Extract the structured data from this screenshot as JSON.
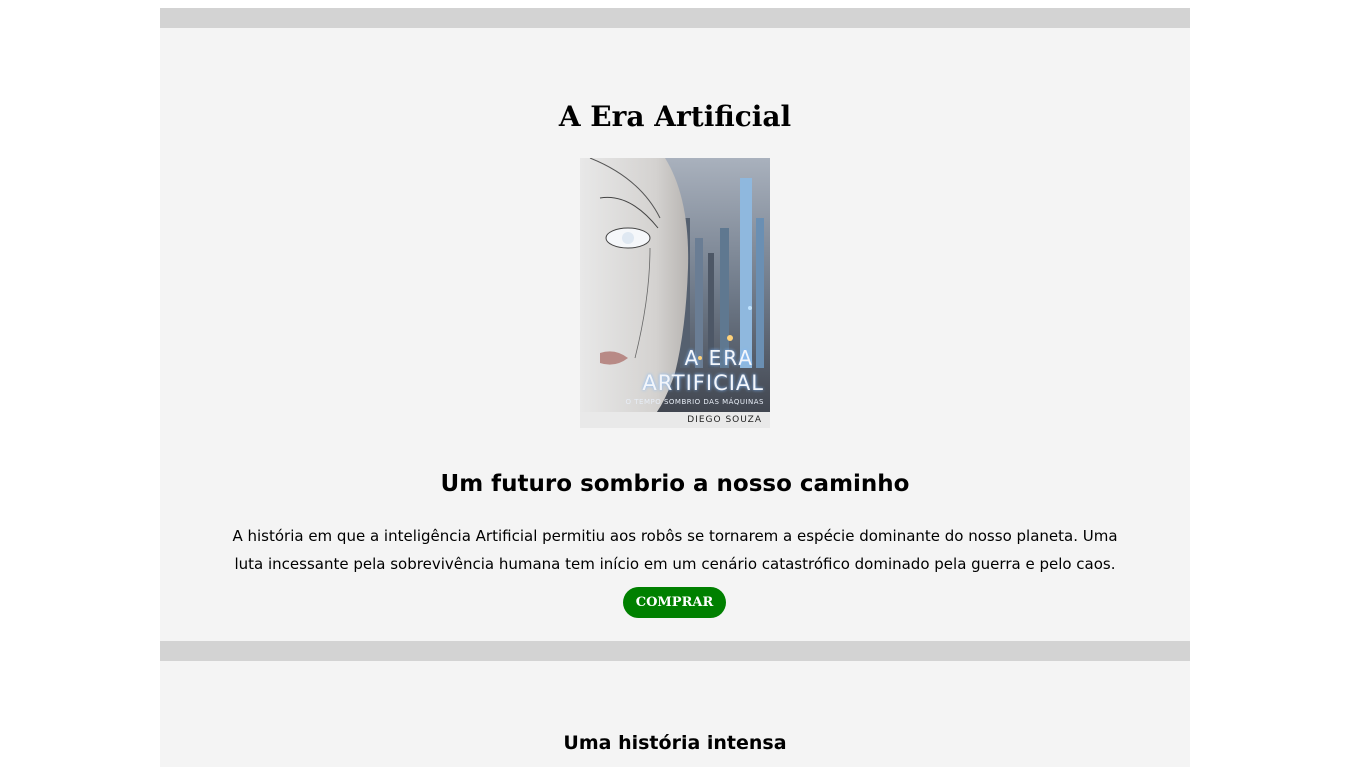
{
  "hero": {
    "title": "A Era Artificial",
    "cover": {
      "title_line1": "A ERA",
      "title_line2": "ARTIFICIAL",
      "tagline": "O TEMPO SOMBRIO DAS MÁQUINAS",
      "author": "DIEGO SOUZA"
    },
    "subtitle": "Um futuro sombrio a nosso caminho",
    "description": "A história em que a inteligência Artificial permitiu aos robôs se tornarem a espécie dominante do nosso planeta. Uma luta incessante pela sobrevivência humana tem início em um cenário catastrófico dominado pela guerra e pelo caos.",
    "buy_label": "COMPRAR"
  },
  "section2": {
    "title": "Uma história intensa"
  },
  "colors": {
    "bar": "#d3d3d3",
    "panel": "#f4f4f4",
    "button": "#008000"
  }
}
